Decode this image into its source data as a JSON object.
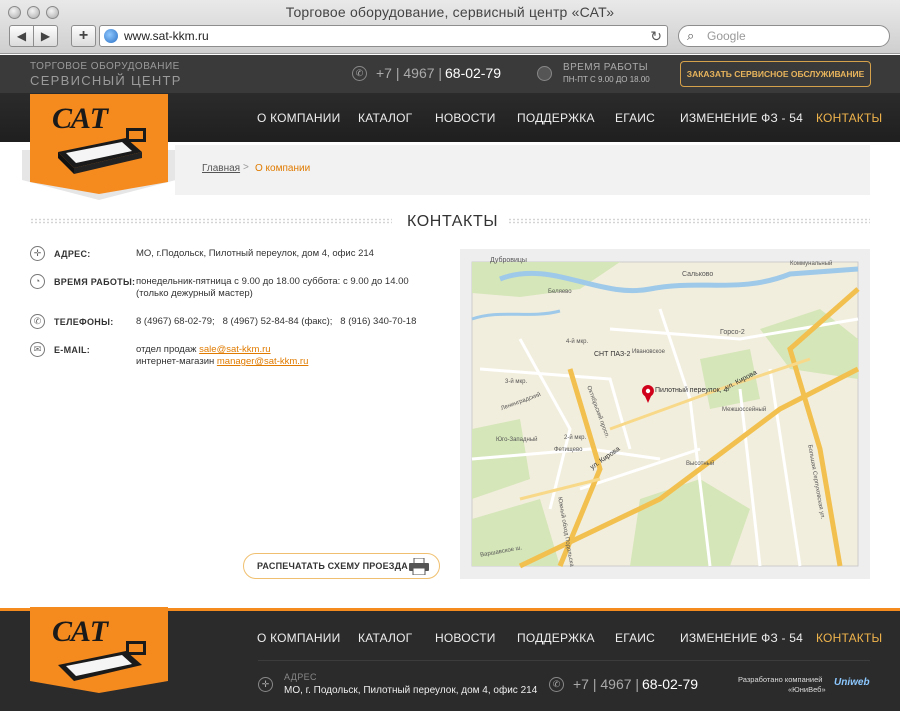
{
  "browser": {
    "window_title": "Торговое оборудование, сервисный центр «САТ»",
    "url": "www.sat-kkm.ru",
    "search_placeholder": "Google"
  },
  "header": {
    "tagline_1": "ТОРГОВОЕ ОБОРУДОВАНИЕ",
    "tagline_2": "СЕРВИСНЫЙ ЦЕНТР",
    "phone_prefix": "+7 | 4967 |",
    "phone_number": "68-02-79",
    "hours_label": "ВРЕМЯ РАБОТЫ",
    "hours_value": "ПН-ПТ  С 9.00 ДО 18.00",
    "order_button": "ЗАКАЗАТЬ СЕРВИСНОЕ ОБСЛУЖИВАНИЕ",
    "logo_text": "САТ"
  },
  "nav": {
    "items": [
      "О КОМПАНИИ",
      "КАТАЛОГ",
      "НОВОСТИ",
      "ПОДДЕРЖКА",
      "ЕГАИС",
      "ИЗМЕНЕНИЕ ФЗ - 54",
      "КОНТАКТЫ"
    ]
  },
  "breadcrumb": {
    "home": "Главная",
    "separator": ">",
    "current": "О компании"
  },
  "page": {
    "title": "КОНТАКТЫ"
  },
  "contacts": {
    "address_label": "АДРЕС:",
    "address_value": "МО, г.Подольск, Пилотный переулок, дом 4, офис 214",
    "hours_label": "ВРЕМЯ РАБОТЫ:",
    "hours_line1": "понедельник-пятница с 9.00 до 18.00 суббота: с 9.00 до 14.00",
    "hours_line2": "(только дежурный мастер)",
    "phones_label": "ТЕЛЕФОНЫ:",
    "phones_value": "8 (4967) 68-02-79;   8 (4967) 52-84-84 (факс);   8 (916) 340-70-18",
    "email_label": "E-MAIL:",
    "email_sales_label": "отдел продаж",
    "email_sales": "sale@sat-kkm.ru",
    "email_shop_label": "интернет-магазин",
    "email_shop": "manager@sat-kkm.ru"
  },
  "print_button": "РАСПЕЧАТАТЬ СХЕМУ ПРОЕЗДА",
  "map": {
    "marker_label": "Пилотный переулок, 4",
    "labels": [
      "Дубровицы",
      "Сальково",
      "Коммунальный",
      "Беляево",
      "СНТ ПАЗ-2",
      "Ивановское",
      "Горсо-2",
      "ул. Кирова",
      "ул. Кирова",
      "Октябрьский просп.",
      "Южный обход Подольска",
      "Варшавское ш.",
      "Большая Серпуховская ул.",
      "Межшоссейный",
      "Высотный",
      "Фетищево",
      "Юго-Западный",
      "3-й мкр.",
      "4-й мкр.",
      "2-й мкр.",
      "Ленинградский"
    ]
  },
  "footer": {
    "nav": [
      "О КОМПАНИИ",
      "КАТАЛОГ",
      "НОВОСТИ",
      "ПОДДЕРЖКА",
      "ЕГАИС",
      "ИЗМЕНЕНИЕ ФЗ - 54",
      "КОНТАКТЫ"
    ],
    "address_label": "АДРЕС",
    "address_value": "МО, г. Подольск, Пилотный переулок, дом 4, офис 214",
    "phone_prefix": "+7 | 4967 |",
    "phone_number": "68-02-79",
    "dev_line1": "Разработано компанией",
    "dev_line2": "«ЮниВеб»",
    "dev_logo": "Uniweb"
  },
  "colors": {
    "accent": "#f58a1f",
    "active_nav": "#f0b44c",
    "dark_bg": "#2b2b2b"
  }
}
